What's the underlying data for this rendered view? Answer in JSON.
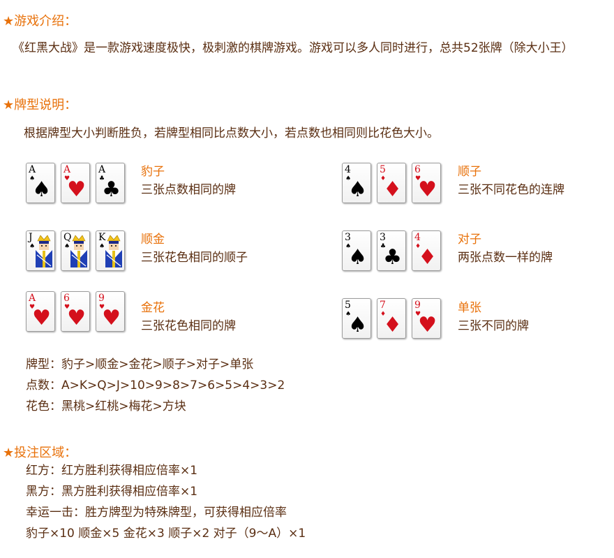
{
  "sections": {
    "intro_title": "★游戏介绍：",
    "types_title": "★牌型说明：",
    "bet_title": "★投注区域："
  },
  "intro": {
    "text": "《红黑大战》是一款游戏速度极快，极刺激的棋牌游戏。游戏可以多人同时进行，总共52张牌（除大小王）"
  },
  "types": {
    "rule": "根据牌型大小判断胜负，若牌型相同比点数大小，若点数也相同则比花色大小。",
    "combos": [
      {
        "name": "豹子",
        "desc": "三张点数相同的牌",
        "cards": [
          {
            "rank": "A",
            "suit": "♠",
            "color": "blk"
          },
          {
            "rank": "A",
            "suit": "♥",
            "color": "red"
          },
          {
            "rank": "A",
            "suit": "♣",
            "color": "blk"
          }
        ]
      },
      {
        "name": "顺子",
        "desc": "三张不同花色的连牌",
        "cards": [
          {
            "rank": "4",
            "suit": "♠",
            "color": "blk"
          },
          {
            "rank": "5",
            "suit": "♦",
            "color": "red"
          },
          {
            "rank": "6",
            "suit": "♥",
            "color": "red"
          }
        ]
      },
      {
        "name": "顺金",
        "desc": "三张花色相同的顺子",
        "cards": [
          {
            "rank": "J",
            "suit": "♠",
            "color": "blk"
          },
          {
            "rank": "Q",
            "suit": "♠",
            "color": "blk"
          },
          {
            "rank": "K",
            "suit": "♠",
            "color": "blk"
          }
        ]
      },
      {
        "name": "对子",
        "desc": "两张点数一样的牌",
        "cards": [
          {
            "rank": "3",
            "suit": "♠",
            "color": "blk"
          },
          {
            "rank": "3",
            "suit": "♣",
            "color": "blk"
          },
          {
            "rank": "4",
            "suit": "♦",
            "color": "red"
          }
        ]
      },
      {
        "name": "金花",
        "desc": "三张花色相同的牌",
        "cards": [
          {
            "rank": "A",
            "suit": "♥",
            "color": "red"
          },
          {
            "rank": "6",
            "suit": "♥",
            "color": "red"
          },
          {
            "rank": "9",
            "suit": "♥",
            "color": "red"
          }
        ]
      },
      {
        "name": "单张",
        "desc": "三张不同的牌",
        "cards": [
          {
            "rank": "5",
            "suit": "♠",
            "color": "blk"
          },
          {
            "rank": "7",
            "suit": "♦",
            "color": "red"
          },
          {
            "rank": "9",
            "suit": "♥",
            "color": "red"
          }
        ]
      }
    ],
    "order_type": "牌型：豹子>顺金>金花>顺子>对子>单张",
    "order_rank": "点数：A>K>Q>J>10>9>8>7>6>5>4>3>2",
    "order_suit": "花色：黑桃>红桃>梅花>方块"
  },
  "bet": {
    "red": "红方：红方胜利获得相应倍率×1",
    "black": "黑方：黑方胜利获得相应倍率×1",
    "lucky": "幸运一击：胜方牌型为特殊牌型，可获得相应倍率",
    "odds": "豹子×10 顺金×5 金花×3 顺子×2 对子（9～A）×1"
  }
}
